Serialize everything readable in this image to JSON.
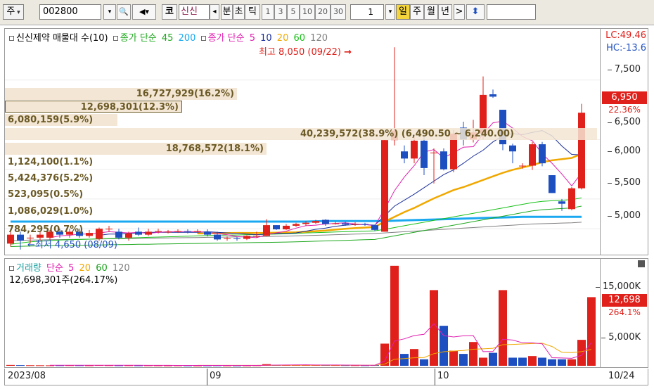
{
  "toolbar": {
    "market": "주",
    "code": "002800",
    "code_tag": "코",
    "stock_short": "신신",
    "unit_buttons": [
      "분",
      "초",
      "틱"
    ],
    "intervals": [
      "1",
      "3",
      "5",
      "10",
      "20",
      "30"
    ],
    "interval_value": "1",
    "periods": [
      "일",
      "주",
      "월",
      "년"
    ],
    "selected_period": "일",
    "prev_label": "◂",
    "next_label": ">"
  },
  "price_panel": {
    "legend_title": "신신제약 매물대 수(10)",
    "legend_close_label": "종가 단순",
    "legend_close_periods": [
      "45",
      "200"
    ],
    "legend_close2_label": "종가 단순",
    "legend_close2_periods": [
      "5",
      "10",
      "20",
      "60",
      "120"
    ],
    "lc_label": "LC:49.46",
    "hc_label": "HC:-13.6",
    "high_annotation": "최고 8,050 (09/22)",
    "low_annotation": "최저 4,650 (08/09)",
    "range_annotation": "(6,490.50 ~ 6,240.00)",
    "current_price": "6,950",
    "current_change": "22.36%",
    "y_ticks": [
      "7,500",
      "6,500",
      "6,000",
      "5,500",
      "5,000"
    ],
    "volume_profile": [
      {
        "label": "16,727,929(16.2%)"
      },
      {
        "label": "12,698,301(12.3%)"
      },
      {
        "label": "6,080,159(5.9%)"
      },
      {
        "label": "40,239,572(38.9%)"
      },
      {
        "label": "18,768,572(18.1%)"
      },
      {
        "label": "1,124,100(1.1%)"
      },
      {
        "label": "5,424,376(5.2%)"
      },
      {
        "label": "523,095(0.5%)"
      },
      {
        "label": "1,086,029(1.0%)"
      },
      {
        "label": "784,295(0.7%)"
      }
    ]
  },
  "volume_panel": {
    "legend_title": "거래량",
    "legend_ma_label": "단순",
    "legend_periods": [
      "5",
      "20",
      "60",
      "120"
    ],
    "volume_readout": "12,698,301주(264.17%)",
    "y_ticks": [
      "15,000K",
      "5,000K"
    ],
    "current_volume": "12,698",
    "current_pct": "264.1%"
  },
  "x_axis": {
    "labels": [
      "2023/08",
      "09",
      "10",
      "10/24"
    ]
  },
  "colors": {
    "up": "#e0201a",
    "down": "#1e4fc0",
    "ma5": "#e020b0",
    "ma10": "#1a2f9c",
    "ma20": "#f0a800",
    "ma60": "#18c018",
    "ma120": "#808080",
    "ma45": "#1fa81f",
    "ma200": "#1aa8f0",
    "profile": "#f3e6d4",
    "profile_text": "#6b5a26"
  },
  "chart_data": {
    "type": "candlestick",
    "price": {
      "ylim": [
        4600,
        8100
      ],
      "candles": [
        {
          "o": 4750,
          "c": 4900,
          "h": 4950,
          "l": 4700
        },
        {
          "o": 4900,
          "c": 4800,
          "h": 4950,
          "l": 4650
        },
        {
          "o": 4850,
          "c": 4850,
          "h": 4900,
          "l": 4750
        },
        {
          "o": 4850,
          "c": 4900,
          "h": 4950,
          "l": 4800
        },
        {
          "o": 4850,
          "c": 4950,
          "h": 4980,
          "l": 4800
        },
        {
          "o": 4950,
          "c": 4900,
          "h": 5000,
          "l": 4850
        },
        {
          "o": 4900,
          "c": 4950,
          "h": 5000,
          "l": 4850
        },
        {
          "o": 4950,
          "c": 4880,
          "h": 5000,
          "l": 4850
        },
        {
          "o": 4880,
          "c": 4930,
          "h": 4980,
          "l": 4850
        },
        {
          "o": 4830,
          "c": 5000,
          "h": 5020,
          "l": 4800
        },
        {
          "o": 5000,
          "c": 5000,
          "h": 5050,
          "l": 4950
        },
        {
          "o": 4950,
          "c": 4850,
          "h": 5000,
          "l": 4820
        },
        {
          "o": 4850,
          "c": 4920,
          "h": 4950,
          "l": 4800
        },
        {
          "o": 4950,
          "c": 4900,
          "h": 5020,
          "l": 4880
        },
        {
          "o": 4900,
          "c": 4950,
          "h": 5000,
          "l": 4880
        },
        {
          "o": 4950,
          "c": 4960,
          "h": 5000,
          "l": 4920
        },
        {
          "o": 4950,
          "c": 4950,
          "h": 4980,
          "l": 4920
        },
        {
          "o": 4950,
          "c": 4960,
          "h": 4990,
          "l": 4930
        },
        {
          "o": 4960,
          "c": 4950,
          "h": 4990,
          "l": 4920
        },
        {
          "o": 4950,
          "c": 4960,
          "h": 4990,
          "l": 4920
        },
        {
          "o": 4950,
          "c": 4900,
          "h": 4990,
          "l": 4870
        },
        {
          "o": 4900,
          "c": 4820,
          "h": 4950,
          "l": 4800
        },
        {
          "o": 4830,
          "c": 4840,
          "h": 4870,
          "l": 4800
        },
        {
          "o": 4840,
          "c": 4830,
          "h": 4860,
          "l": 4800
        },
        {
          "o": 4830,
          "c": 4880,
          "h": 4890,
          "l": 4810
        },
        {
          "o": 4870,
          "c": 4880,
          "h": 4950,
          "l": 4850
        },
        {
          "o": 4880,
          "c": 5060,
          "h": 5160,
          "l": 4880
        },
        {
          "o": 5060,
          "c": 4990,
          "h": 5060,
          "l": 4980
        },
        {
          "o": 4990,
          "c": 5050,
          "h": 5080,
          "l": 4980
        },
        {
          "o": 5050,
          "c": 5080,
          "h": 5100,
          "l": 5030
        },
        {
          "o": 5080,
          "c": 5100,
          "h": 5130,
          "l": 5050
        },
        {
          "o": 5100,
          "c": 5130,
          "h": 5150,
          "l": 5080
        },
        {
          "o": 5150,
          "c": 5080,
          "h": 5160,
          "l": 5050
        },
        {
          "o": 5080,
          "c": 5090,
          "h": 5120,
          "l": 5070
        },
        {
          "o": 5090,
          "c": 5070,
          "h": 5120,
          "l": 5050
        },
        {
          "o": 5070,
          "c": 5080,
          "h": 5110,
          "l": 5050
        },
        {
          "o": 5080,
          "c": 5070,
          "h": 5100,
          "l": 5050
        },
        {
          "o": 5060,
          "c": 4980,
          "h": 5070,
          "l": 4960
        },
        {
          "o": 4950,
          "c": 6490,
          "h": 6490,
          "l": 4950
        },
        {
          "o": 6490,
          "c": 6650,
          "h": 8050,
          "l": 6400
        },
        {
          "o": 6300,
          "c": 6180,
          "h": 6400,
          "l": 6100
        },
        {
          "o": 6180,
          "c": 6480,
          "h": 6540,
          "l": 6100
        },
        {
          "o": 6480,
          "c": 6020,
          "h": 6560,
          "l": 5900
        },
        {
          "o": 6280,
          "c": 6280,
          "h": 6350,
          "l": 5760
        },
        {
          "o": 6300,
          "c": 6000,
          "h": 6350,
          "l": 5980
        },
        {
          "o": 6000,
          "c": 6600,
          "h": 6660,
          "l": 5950
        },
        {
          "o": 6700,
          "c": 6500,
          "h": 6800,
          "l": 6400
        },
        {
          "o": 6500,
          "c": 6620,
          "h": 6830,
          "l": 6450
        },
        {
          "o": 6600,
          "c": 7250,
          "h": 7560,
          "l": 6500
        },
        {
          "o": 7260,
          "c": 7220,
          "h": 7340,
          "l": 7200
        },
        {
          "o": 7000,
          "c": 6420,
          "h": 7000,
          "l": 6320
        },
        {
          "o": 6400,
          "c": 6300,
          "h": 6430,
          "l": 6100
        },
        {
          "o": 6060,
          "c": 6060,
          "h": 6100,
          "l": 6010
        },
        {
          "o": 6060,
          "c": 6420,
          "h": 6460,
          "l": 5990
        },
        {
          "o": 6420,
          "c": 6100,
          "h": 6460,
          "l": 6050
        },
        {
          "o": 5900,
          "c": 5600,
          "h": 5900,
          "l": 5600
        },
        {
          "o": 5460,
          "c": 5420,
          "h": 5500,
          "l": 5300
        },
        {
          "o": 5330,
          "c": 5680,
          "h": 5700,
          "l": 5310
        },
        {
          "o": 5680,
          "c": 6950,
          "h": 7100,
          "l": 5660
        }
      ],
      "ma5": [
        null,
        null,
        null,
        null,
        4850,
        4880,
        4890,
        4910,
        4910,
        4930,
        4950,
        4940,
        4930,
        4940,
        4920,
        4940,
        4950,
        4950,
        4950,
        4950,
        4940,
        4920,
        4900,
        4870,
        4860,
        4850,
        4900,
        4930,
        4960,
        5010,
        5050,
        5060,
        5080,
        5090,
        5100,
        5080,
        5070,
        5050,
        5330,
        5640,
        5870,
        6060,
        6290,
        6330,
        6190,
        6280,
        6370,
        6380,
        6590,
        6780,
        6810,
        6690,
        6550,
        6480,
        6260,
        6100,
        5920,
        5720,
        5940
      ],
      "ma10": [
        null,
        null,
        null,
        null,
        null,
        null,
        null,
        null,
        null,
        4890,
        4910,
        4910,
        4920,
        4930,
        4940,
        4940,
        4940,
        4940,
        4940,
        4940,
        4950,
        4940,
        4930,
        4920,
        4910,
        4900,
        4910,
        4920,
        4920,
        4930,
        4960,
        4990,
        5010,
        5040,
        5060,
        5070,
        5070,
        5060,
        5220,
        5380,
        5480,
        5580,
        5690,
        5800,
        5910,
        5990,
        6100,
        6220,
        6320,
        6460,
        6560,
        6600,
        6580,
        6620,
        6650,
        6560,
        6390,
        6250,
        6240
      ],
      "ma20": [
        null,
        null,
        null,
        null,
        null,
        null,
        null,
        null,
        null,
        null,
        null,
        null,
        null,
        null,
        null,
        null,
        null,
        null,
        null,
        4920,
        4920,
        4925,
        4928,
        4930,
        4930,
        4928,
        4930,
        4935,
        4938,
        4940,
        4950,
        4960,
        4970,
        4985,
        5000,
        5010,
        5020,
        5030,
        5120,
        5200,
        5280,
        5350,
        5430,
        5510,
        5580,
        5650,
        5700,
        5760,
        5820,
        5880,
        5940,
        5990,
        6030,
        6070,
        6120,
        6150,
        6170,
        6190,
        6260
      ],
      "ma60": [
        4740,
        4760,
        4780,
        4790,
        4800,
        4810,
        4815,
        4820,
        4825,
        4830,
        4835,
        4840,
        4845,
        4850,
        4855,
        4860,
        4865,
        4870,
        4875,
        4880,
        4885,
        4890,
        4895,
        4895,
        4900,
        4900,
        4905,
        4910,
        4915,
        4920,
        4930,
        4935,
        4940,
        4945,
        4950,
        4955,
        4960,
        4965,
        4990,
        5020,
        5050,
        5080,
        5110,
        5140,
        5170,
        5200,
        5230,
        5260,
        5290,
        5320,
        5350,
        5380,
        5410,
        5440,
        5460,
        5470,
        5480,
        5490,
        5520
      ],
      "ma120": [
        4800,
        4805,
        4810,
        4812,
        4815,
        4818,
        4820,
        4822,
        4825,
        4828,
        4830,
        4832,
        4835,
        4838,
        4840,
        4843,
        4845,
        4848,
        4850,
        4852,
        4855,
        4858,
        4860,
        4862,
        4865,
        4868,
        4870,
        4873,
        4876,
        4880,
        4885,
        4890,
        4895,
        4900,
        4905,
        4910,
        4915,
        4920,
        4930,
        4940,
        4950,
        4960,
        4970,
        4980,
        4990,
        5000,
        5010,
        5020,
        5030,
        5040,
        5050,
        5060,
        5070,
        5080,
        5085,
        5090,
        5095,
        5100,
        5110
      ],
      "ma45": [
        4700,
        4705,
        4710,
        4712,
        4715,
        4718,
        4720,
        4722,
        4725,
        4728,
        4730,
        4733,
        4735,
        4738,
        4740,
        4743,
        4745,
        4748,
        4750,
        4752,
        4755,
        4758,
        4760,
        4762,
        4765,
        4768,
        4770,
        4773,
        4776,
        4780,
        4785,
        4790,
        4795,
        4800,
        4805,
        4810,
        4815,
        4820,
        4850,
        4880,
        4910,
        4940,
        4970,
        5000,
        5030,
        5060,
        5090,
        5120,
        5150,
        5180,
        5210,
        5240,
        5270,
        5300,
        5320,
        5330,
        5340,
        5350,
        5380
      ],
      "ma200": [
        5120,
        5120,
        5120,
        5120,
        5120,
        5120,
        5120,
        5120,
        5120,
        5120,
        5120,
        5120,
        5120,
        5120,
        5120,
        5120,
        5120,
        5120,
        5120,
        5120,
        5120,
        5120,
        5120,
        5120,
        5120,
        5120,
        5120,
        5120,
        5120,
        5120,
        5120,
        5125,
        5130,
        5130,
        5130,
        5130,
        5130,
        5130,
        5130,
        5135,
        5140,
        5145,
        5150,
        5155,
        5160,
        5165,
        5170,
        5175,
        5180,
        5185,
        5190,
        5195,
        5200,
        5200,
        5200,
        5200,
        5200,
        5200,
        5200
      ]
    },
    "volume": {
      "ylim": [
        0,
        19000
      ],
      "values": [
        150,
        120,
        100,
        90,
        80,
        90,
        100,
        90,
        80,
        120,
        100,
        80,
        90,
        70,
        80,
        70,
        60,
        70,
        60,
        50,
        60,
        70,
        60,
        50,
        60,
        80,
        300,
        150,
        130,
        140,
        160,
        140,
        130,
        120,
        110,
        100,
        90,
        120,
        4100,
        18500,
        2200,
        3100,
        1200,
        14000,
        7400,
        2800,
        2200,
        4400,
        1500,
        2400,
        14000,
        1500,
        1500,
        1800,
        1500,
        1200,
        1200,
        1200,
        4800,
        12698
      ],
      "up": [
        1,
        0,
        1,
        1,
        1,
        0,
        1,
        0,
        1,
        1,
        1,
        0,
        1,
        0,
        1,
        1,
        1,
        1,
        0,
        1,
        0,
        0,
        1,
        0,
        1,
        1,
        1,
        0,
        1,
        1,
        1,
        1,
        0,
        1,
        0,
        1,
        0,
        0,
        1,
        1,
        0,
        1,
        0,
        1,
        0,
        1,
        0,
        1,
        1,
        0,
        1,
        0,
        0,
        1,
        0,
        0,
        0,
        1,
        1,
        1
      ],
      "ma5": [
        null,
        null,
        null,
        null,
        108,
        96,
        92,
        90,
        88,
        96,
        98,
        94,
        94,
        92,
        84,
        78,
        72,
        70,
        66,
        62,
        62,
        62,
        62,
        58,
        60,
        64,
        110,
        128,
        144,
        156,
        176,
        144,
        140,
        138,
        132,
        120,
        110,
        108,
        888,
        4580,
        4990,
        5600,
        5820,
        7800,
        5580,
        5340,
        5540,
        5580,
        2620,
        2660,
        4900,
        4760,
        4260,
        4240,
        4060,
        1500,
        1440,
        1380,
        1940,
        4300
      ],
      "ma20": [
        null,
        null,
        null,
        null,
        null,
        null,
        null,
        null,
        null,
        null,
        null,
        null,
        null,
        null,
        null,
        null,
        null,
        null,
        null,
        82,
        80,
        78,
        76,
        74,
        72,
        72,
        82,
        84,
        86,
        90,
        94,
        96,
        98,
        100,
        102,
        104,
        105,
        108,
        304,
        1226,
        1330,
        1480,
        1540,
        2240,
        2600,
        2730,
        2840,
        3060,
        3130,
        3240,
        3900,
        3960,
        4030,
        4110,
        4180,
        3560,
        2490,
        2440,
        2620,
        3020
      ]
    },
    "x_labels": [
      "2023/08",
      "09",
      "10",
      "10/24"
    ]
  }
}
